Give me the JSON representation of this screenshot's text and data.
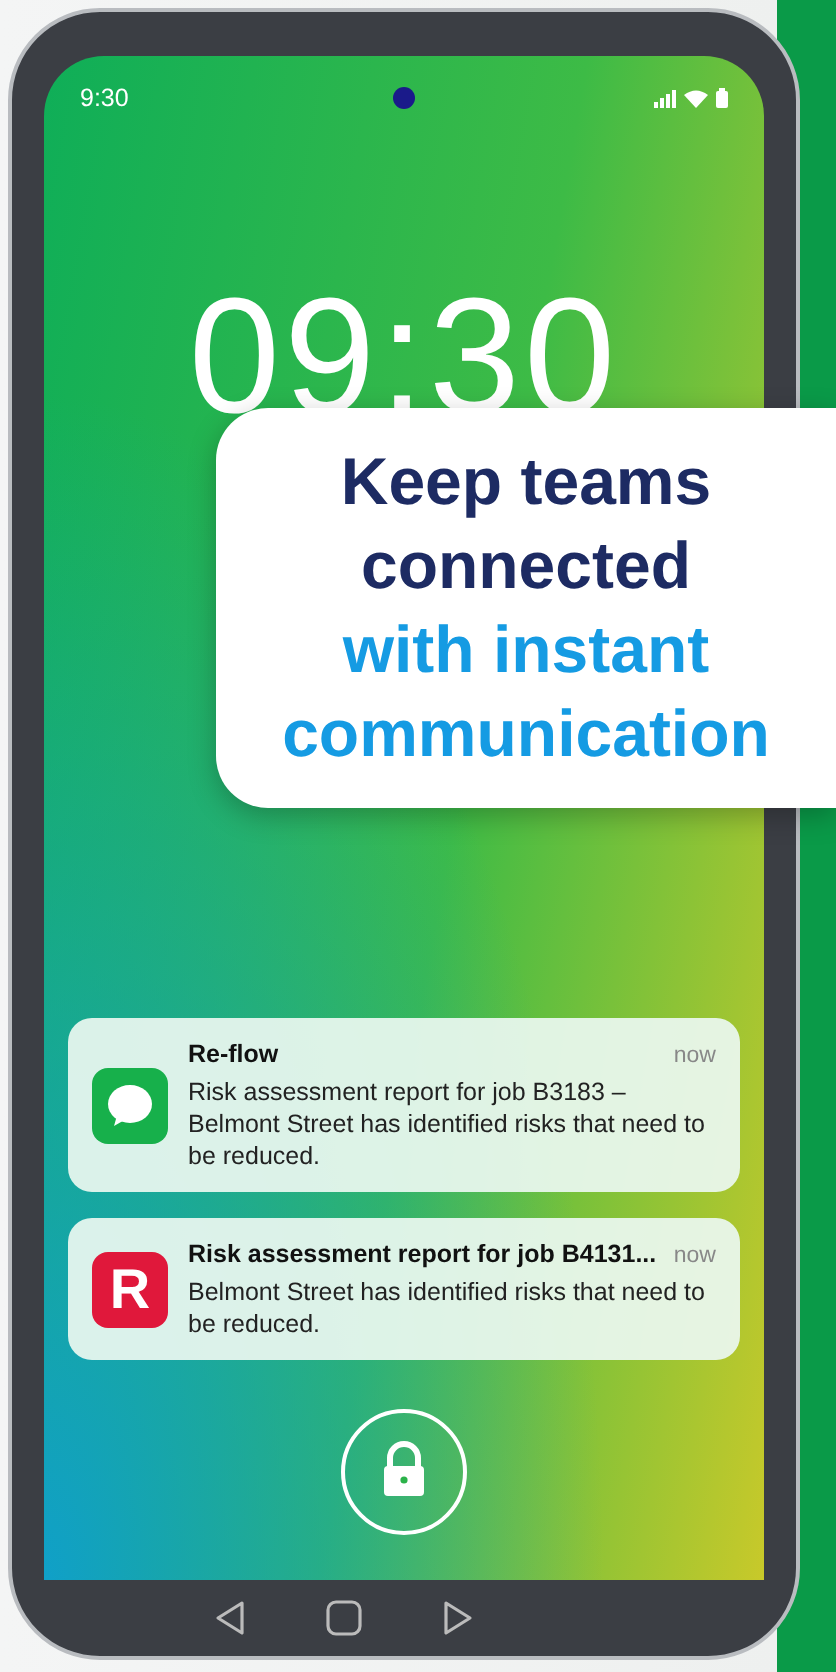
{
  "status_bar": {
    "time": "9:30"
  },
  "lock_screen": {
    "clock": "09:30"
  },
  "callout": {
    "lines": [
      {
        "text": "Keep teams",
        "kind": "primary"
      },
      {
        "text": "connected",
        "kind": "primary"
      },
      {
        "text": "with instant",
        "kind": "accent"
      },
      {
        "text": "communication",
        "kind": "accent"
      }
    ]
  },
  "notifications": [
    {
      "icon": {
        "kind": "chat"
      },
      "title": "Re-flow",
      "time": "now",
      "body": "Risk assessment report for job B3183 – Belmont Street has identified risks that need to be reduced."
    },
    {
      "icon": {
        "kind": "letter",
        "letter": "R"
      },
      "title": "Risk assessment report for job B4131...",
      "time": "now",
      "body": "Belmont Street has identified risks that need to be reduced."
    }
  ]
}
